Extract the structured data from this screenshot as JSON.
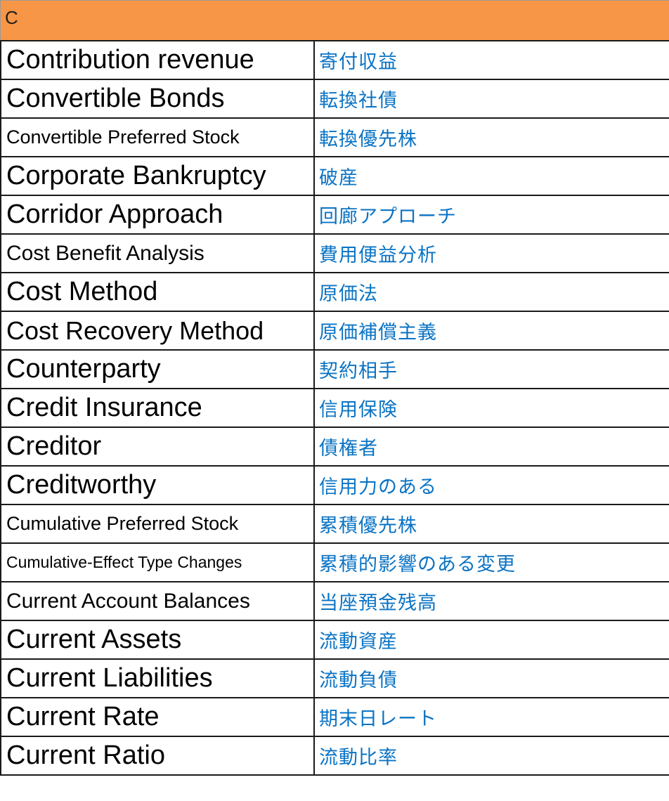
{
  "header": {
    "letter": "C",
    "background": "#f79646"
  },
  "colors": {
    "english_text": "#000000",
    "japanese_text": "#0a73c4",
    "grid": "#1a1a1a"
  },
  "rows": [
    {
      "en": "Contribution revenue",
      "jp": "寄付収益"
    },
    {
      "en": "Convertible Bonds",
      "jp": "転換社債"
    },
    {
      "en": "Convertible Preferred Stock",
      "jp": "転換優先株"
    },
    {
      "en": "Corporate Bankruptcy",
      "jp": "破産"
    },
    {
      "en": "Corridor Approach",
      "jp": "回廊アプローチ"
    },
    {
      "en": "Cost Benefit Analysis",
      "jp": "費用便益分析"
    },
    {
      "en": "Cost Method",
      "jp": "原価法"
    },
    {
      "en": "Cost Recovery Method",
      "jp": "原価補償主義"
    },
    {
      "en": "Counterparty",
      "jp": "契約相手"
    },
    {
      "en": "Credit Insurance",
      "jp": "信用保険"
    },
    {
      "en": "Creditor",
      "jp": "債権者"
    },
    {
      "en": "Creditworthy",
      "jp": "信用力のある"
    },
    {
      "en": "Cumulative Preferred Stock",
      "jp": "累積優先株"
    },
    {
      "en": "Cumulative-Effect Type Changes",
      "jp": "累積的影響のある変更"
    },
    {
      "en": "Current Account Balances",
      "jp": "当座預金残高"
    },
    {
      "en": "Current Assets",
      "jp": "流動資産"
    },
    {
      "en": "Current Liabilities",
      "jp": "流動負債"
    },
    {
      "en": "Current Rate",
      "jp": "期末日レート"
    },
    {
      "en": "Current Ratio",
      "jp": "流動比率"
    }
  ]
}
